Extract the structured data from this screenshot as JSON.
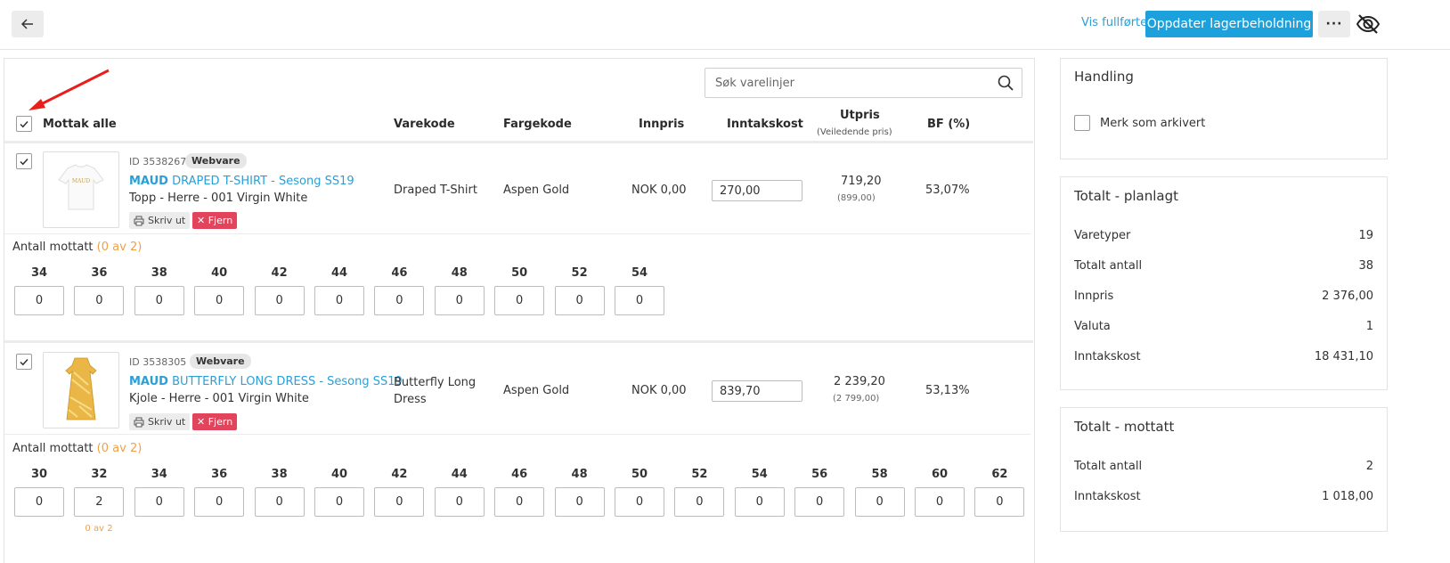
{
  "topbar": {
    "back_icon": "arrow-left-icon",
    "show_completed": "Vis fullførte",
    "update_stock": "Oppdater lagerbeholdning",
    "more": "···",
    "visibility_icon": "eye-off-icon",
    "accent_color": "#1da1dd"
  },
  "search": {
    "placeholder": "Søk varelinjer",
    "icon": "search-icon"
  },
  "table": {
    "receive_all": "Mottak alle",
    "receive_all_checked": true,
    "headers": {
      "varekode": "Varekode",
      "fargekode": "Fargekode",
      "innpris": "Innpris",
      "inntakskost": "Inntakskost",
      "utpris": "Utpris",
      "utpris_sub": "(Veiledende pris)",
      "bf": "BF (%)"
    }
  },
  "items": [
    {
      "id": "ID 3538267",
      "badge": "Webvare",
      "brand": "MAUD",
      "title": "DRAPED T-SHIRT - Sesong SS19",
      "desc": "Topp - Herre - 001 Virgin White",
      "print": "Skriv ut",
      "remove": "✕ Fjern",
      "varekode": "Draped T-Shirt",
      "fargekode": "Aspen Gold",
      "innpris": "NOK 0,00",
      "inntakskost": "270,00",
      "utpris": "719,20",
      "utpris_sub": "(899,00)",
      "bf": "53,07%",
      "received_label": "Antall mottatt",
      "received_count": "(0 av 2)",
      "sizes": [
        "34",
        "36",
        "38",
        "40",
        "42",
        "44",
        "46",
        "48",
        "50",
        "52",
        "54"
      ],
      "quantities": [
        "0",
        "0",
        "0",
        "0",
        "0",
        "0",
        "0",
        "0",
        "0",
        "0",
        "0"
      ]
    },
    {
      "id": "ID 3538305",
      "badge": "Webvare",
      "brand": "MAUD",
      "title": "BUTTERFLY LONG DRESS - Sesong SS19",
      "desc": "Kjole - Herre - 001 Virgin White",
      "print": "Skriv ut",
      "remove": "✕ Fjern",
      "varekode_line1": "Butterfly Long",
      "varekode_line2": "Dress",
      "fargekode": "Aspen Gold",
      "innpris": "NOK 0,00",
      "inntakskost": "839,70",
      "utpris": "2 239,20",
      "utpris_sub": "(2 799,00)",
      "bf": "53,13%",
      "received_label": "Antall mottatt",
      "received_count": "(0 av 2)",
      "sizes": [
        "30",
        "32",
        "34",
        "36",
        "38",
        "40",
        "42",
        "44",
        "46",
        "48",
        "50",
        "52",
        "54",
        "56",
        "58",
        "60",
        "62"
      ],
      "quantities": [
        "0",
        "2",
        "0",
        "0",
        "0",
        "0",
        "0",
        "0",
        "0",
        "0",
        "0",
        "0",
        "0",
        "0",
        "0",
        "0",
        "0"
      ],
      "size_note": "0 av 2"
    }
  ],
  "sidebar": {
    "action": {
      "title": "Handling",
      "archive_label": "Merk som arkivert"
    },
    "planned": {
      "title": "Totalt - planlagt",
      "rows": [
        {
          "label": "Varetyper",
          "value": "19"
        },
        {
          "label": "Totalt antall",
          "value": "38"
        },
        {
          "label": "Innpris",
          "value": "2 376,00"
        },
        {
          "label": "Valuta",
          "value": "1"
        },
        {
          "label": "Inntakskost",
          "value": "18 431,10"
        }
      ]
    },
    "received": {
      "title": "Totalt - mottatt",
      "rows": [
        {
          "label": "Totalt antall",
          "value": "2"
        },
        {
          "label": "Inntakskost",
          "value": "1 018,00"
        }
      ]
    }
  }
}
